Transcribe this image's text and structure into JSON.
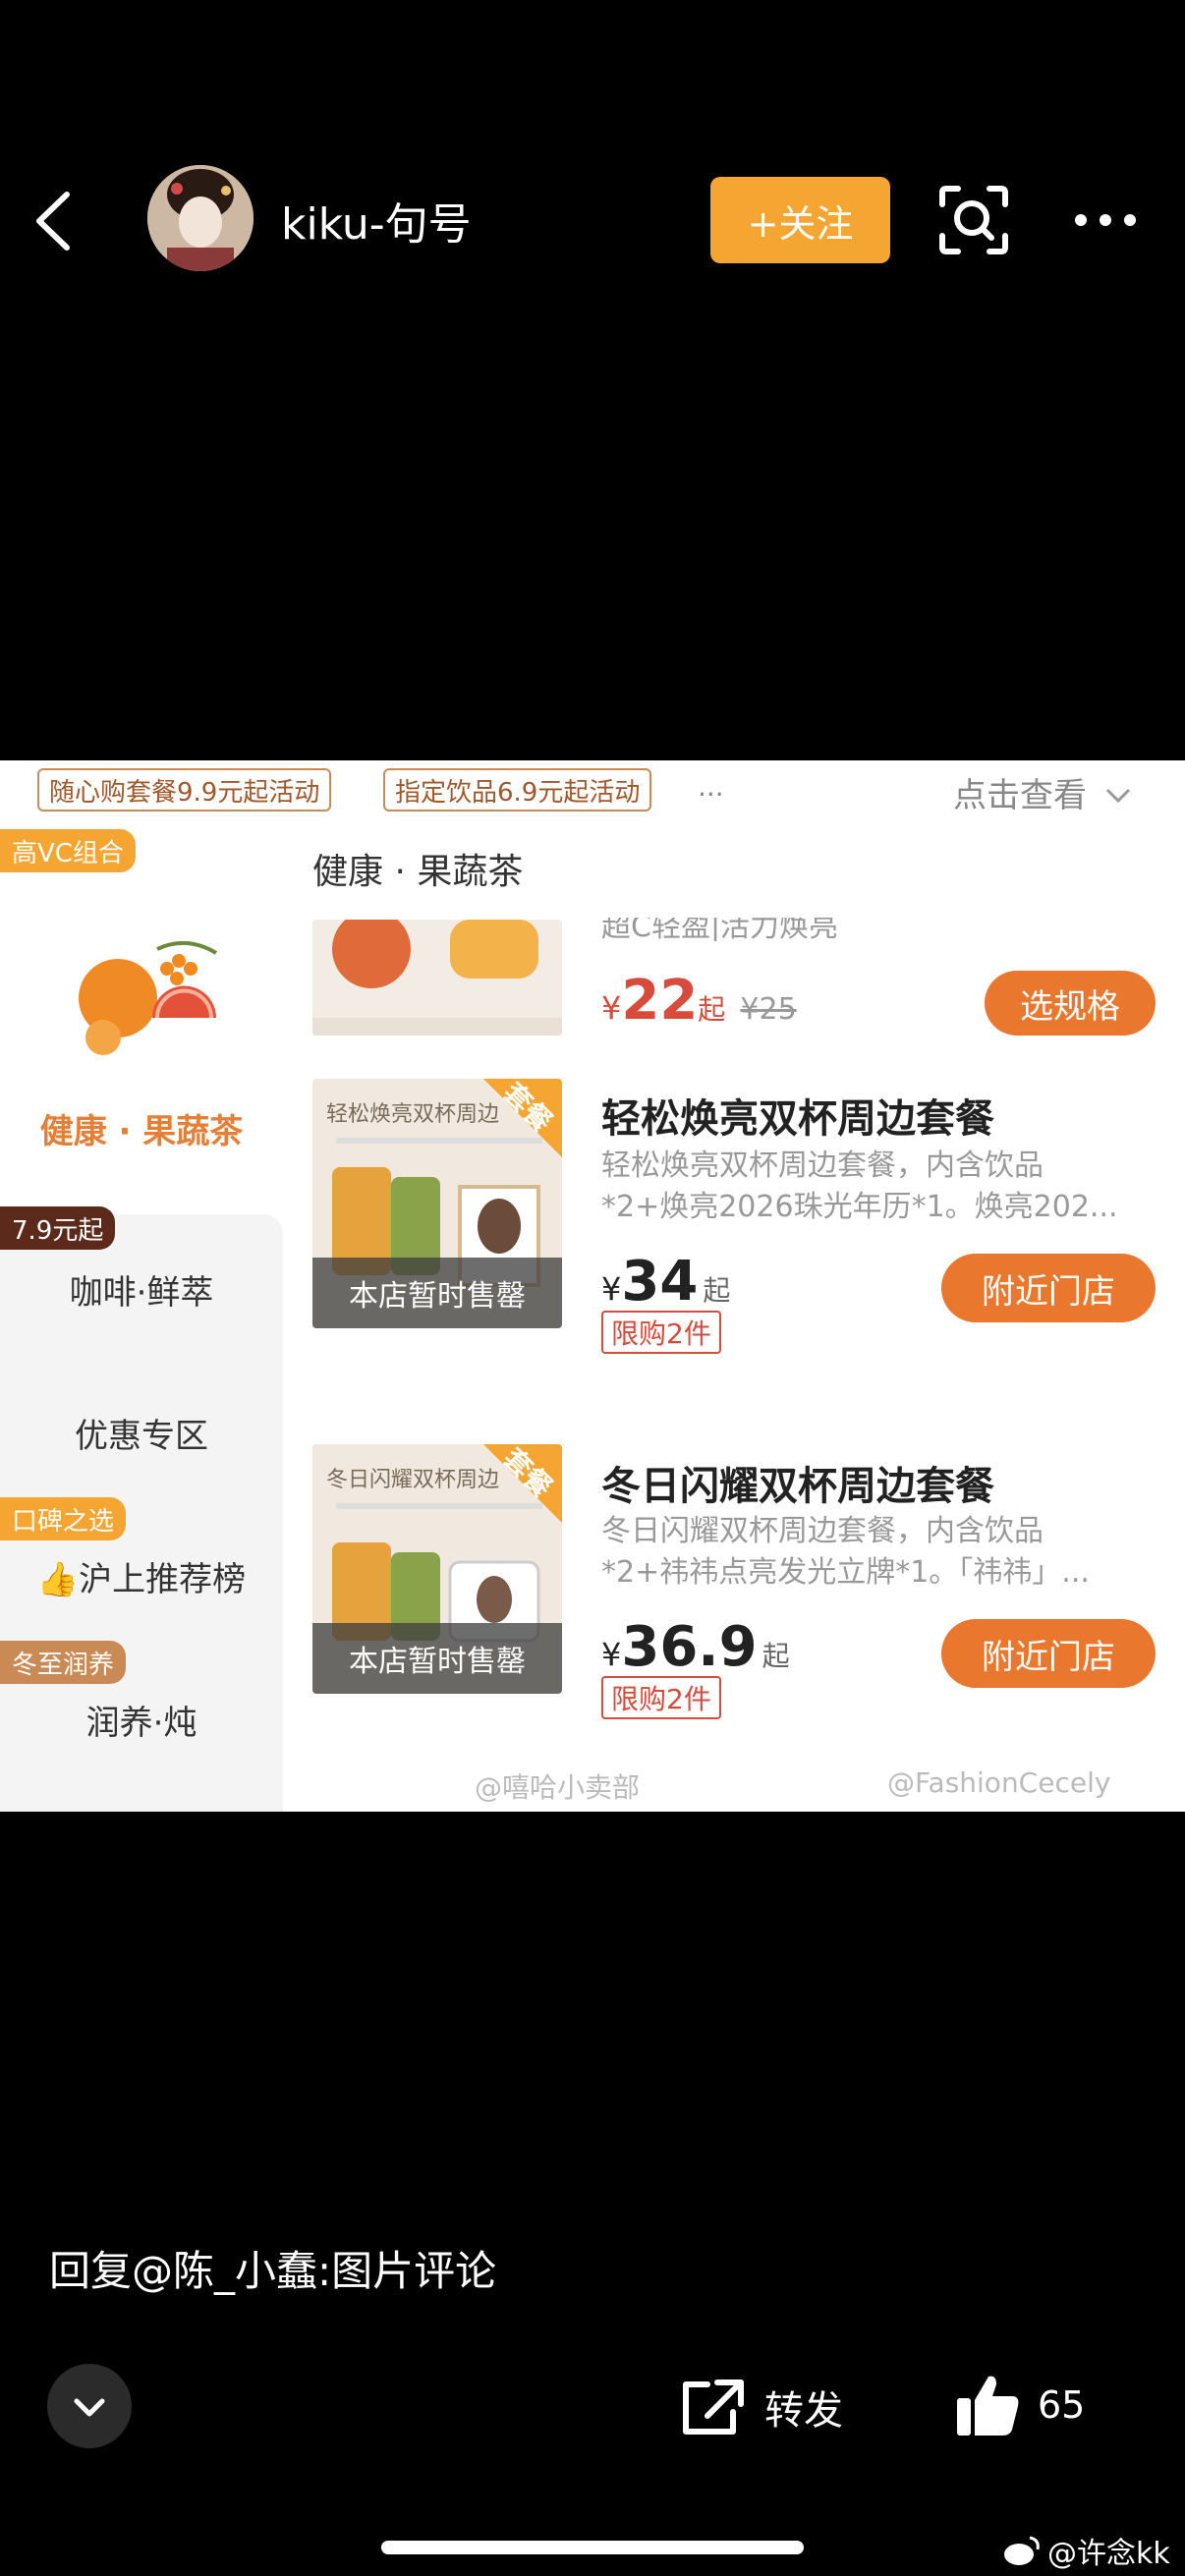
{
  "header": {
    "username": "kiku-句号",
    "follow_label": "+关注"
  },
  "image": {
    "promos": [
      "随心购套餐9.9元起活动",
      "指定饮品6.9元起活动"
    ],
    "promo_more": "...",
    "view_more": "点击查看",
    "left_nav": {
      "tag_high_vc": "高VC组合",
      "active": "健康 · 果蔬茶",
      "tag_price": "7.9元起",
      "item_coffee": "咖啡·鲜萃",
      "item_discount": "优惠专区",
      "tag_reputation": "口碑之选",
      "item_ranking": "👍沪上推荐榜",
      "tag_winter": "冬至润养",
      "item_stew": "润养·炖"
    },
    "section_title": "健康 · 果蔬茶",
    "product0": {
      "desc": "超C轻盈|活力焕亮",
      "price_yen": "¥",
      "price": "22",
      "price_suffix": "起",
      "original_price": "¥25",
      "button": "选规格"
    },
    "product1": {
      "name": "轻松焕亮双杯周边套餐",
      "desc_line1": "轻松焕亮双杯周边套餐，内含饮品",
      "desc_line2": "*2+焕亮2026珠光年历*1。焕亮202...",
      "thumb_title": "轻松焕亮双杯周边",
      "corner": "套餐",
      "sold_out": "本店暂时售罄",
      "price_yen": "¥",
      "price": "34",
      "price_suffix": "起",
      "limit": "限购2件",
      "button": "附近门店"
    },
    "product2": {
      "name": "冬日闪耀双杯周边套餐",
      "desc_line1": "冬日闪耀双杯周边套餐，内含饮品",
      "desc_line2": "*2+祎祎点亮发光立牌*1。「祎祎」...",
      "thumb_title": "冬日闪耀双杯周边",
      "corner": "套餐",
      "sold_out": "本店暂时售罄",
      "price_yen": "¥",
      "price": "36.9",
      "price_suffix": "起",
      "limit": "限购2件",
      "button": "附近门店"
    },
    "watermarks": [
      "@嘻哈小卖部",
      "@FashionCecely"
    ]
  },
  "footer": {
    "reply_text": "回复@陈_小蠢:图片评论",
    "repost_label": "转发",
    "like_count": "65",
    "watermark": "@许念kk"
  },
  "colors": {
    "follow": "#f5a532",
    "accent_orange": "#e9772e",
    "price_red": "#d84a3a"
  }
}
